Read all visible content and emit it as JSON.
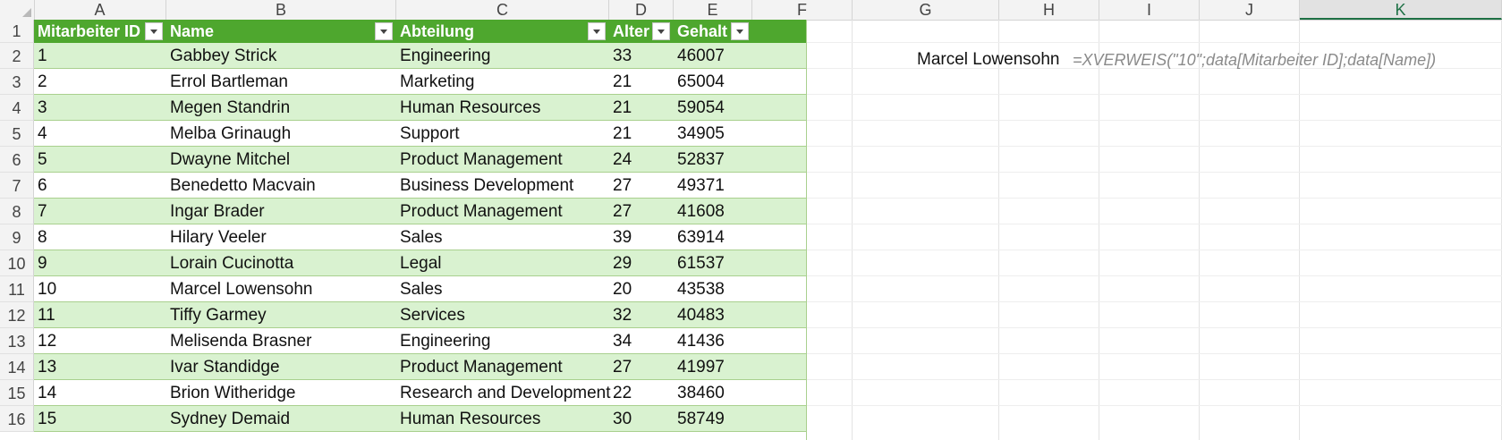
{
  "columns": [
    "A",
    "B",
    "C",
    "D",
    "E",
    "F",
    "G",
    "H",
    "I",
    "J",
    "K"
  ],
  "rows": [
    "1",
    "2",
    "3",
    "4",
    "5",
    "6",
    "7",
    "8",
    "9",
    "10",
    "11",
    "12",
    "13",
    "14",
    "15",
    "16"
  ],
  "table": {
    "headers": [
      "Mitarbeiter ID",
      "Name",
      "Abteilung",
      "Alter",
      "Gehalt"
    ],
    "data": [
      [
        "1",
        "Gabbey Strick",
        "Engineering",
        "33",
        "46007"
      ],
      [
        "2",
        "Errol Bartleman",
        "Marketing",
        "21",
        "65004"
      ],
      [
        "3",
        "Megen Standrin",
        "Human Resources",
        "21",
        "59054"
      ],
      [
        "4",
        "Melba Grinaugh",
        "Support",
        "21",
        "34905"
      ],
      [
        "5",
        "Dwayne Mitchel",
        "Product Management",
        "24",
        "52837"
      ],
      [
        "6",
        "Benedetto Macvain",
        "Business Development",
        "27",
        "49371"
      ],
      [
        "7",
        "Ingar Brader",
        "Product Management",
        "27",
        "41608"
      ],
      [
        "8",
        "Hilary Veeler",
        "Sales",
        "39",
        "63914"
      ],
      [
        "9",
        "Lorain Cucinotta",
        "Legal",
        "29",
        "61537"
      ],
      [
        "10",
        "Marcel Lowensohn",
        "Sales",
        "20",
        "43538"
      ],
      [
        "11",
        "Tiffy Garmey",
        "Services",
        "32",
        "40483"
      ],
      [
        "12",
        "Melisenda Brasner",
        "Engineering",
        "34",
        "41436"
      ],
      [
        "13",
        "Ivar Standidge",
        "Product Management",
        "27",
        "41997"
      ],
      [
        "14",
        "Brion Witheridge",
        "Research and Development",
        "22",
        "38460"
      ],
      [
        "15",
        "Sydney Demaid",
        "Human Resources",
        "30",
        "58749"
      ]
    ]
  },
  "result": {
    "value": "Marcel Lowensohn",
    "formula": "=XVERWEIS(\"10\";data[Mitarbeiter ID];data[Name])"
  },
  "colors": {
    "header_green": "#4ea72e",
    "band_green": "#d9f2d0",
    "selected_column": "K"
  }
}
